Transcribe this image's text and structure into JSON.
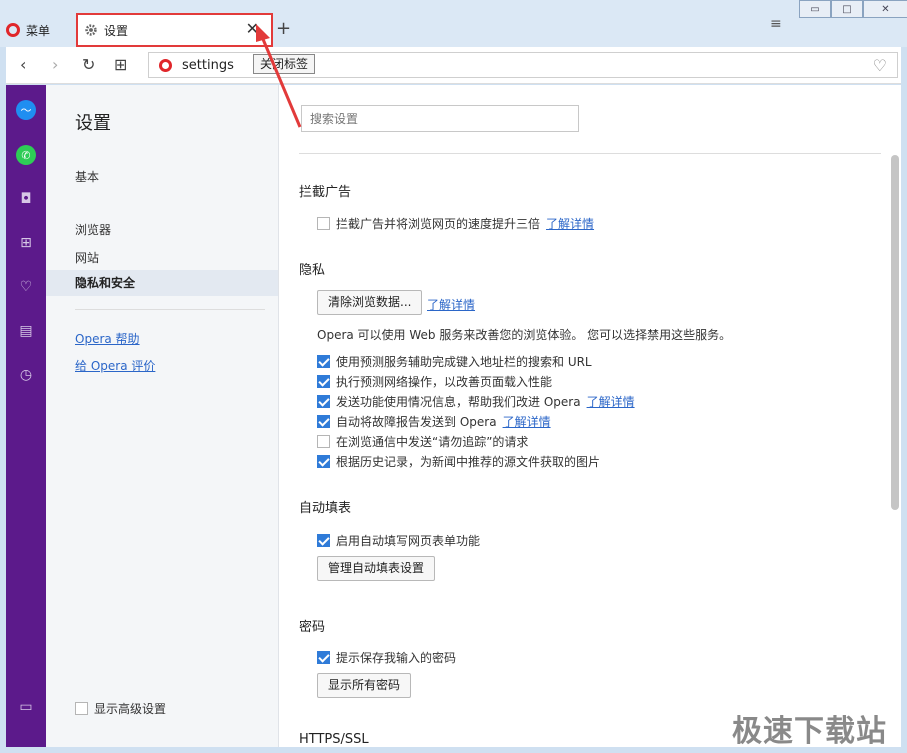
{
  "titlebar": {
    "menu_label": "菜单",
    "tab_title": "设置",
    "close_glyph": "✕",
    "new_tab_glyph": "+",
    "tab_menu_glyph": "≡",
    "tooltip": "关闭标签"
  },
  "window_controls": {
    "minimize": "▭",
    "maximize": "□",
    "close": "✕"
  },
  "addressbar": {
    "url": "settings",
    "back": "‹",
    "forward": "›",
    "reload": "↻",
    "grid": "⊞",
    "heart": "♡"
  },
  "sidebar": {
    "icons": [
      "messenger-icon",
      "whatsapp-icon",
      "camera-icon",
      "speed-dial-icon",
      "heart-icon",
      "news-icon",
      "history-icon",
      "sidebar-toggle-icon"
    ],
    "accent_color": "#5c1a8b"
  },
  "settings_nav": {
    "title": "设置",
    "items": [
      "基本",
      "浏览器",
      "网站",
      "隐私和安全"
    ],
    "active_item": "隐私和安全",
    "links": [
      "Opera 帮助",
      "给 Opera 评价"
    ],
    "advanced_label": "显示高级设置"
  },
  "content": {
    "search_placeholder": "搜索设置",
    "adblock": {
      "title": "拦截广告",
      "option": "拦截广告并将浏览网页的速度提升三倍",
      "link": "了解详情",
      "checked": false
    },
    "privacy": {
      "title": "隐私",
      "clear_button": "清除浏览数据...",
      "clear_link": "了解详情",
      "description": "Opera 可以使用 Web 服务来改善您的浏览体验。 您可以选择禁用这些服务。",
      "options": [
        {
          "label": "使用预测服务辅助完成键入地址栏的搜索和 URL",
          "checked": true,
          "link": ""
        },
        {
          "label": "执行预测网络操作，以改善页面载入性能",
          "checked": true,
          "link": ""
        },
        {
          "label": "发送功能使用情况信息，帮助我们改进 Opera",
          "checked": true,
          "link": "了解详情"
        },
        {
          "label": "自动将故障报告发送到 Opera",
          "checked": true,
          "link": "了解详情"
        },
        {
          "label": "在浏览通信中发送“请勿追踪”的请求",
          "checked": false,
          "link": ""
        },
        {
          "label": "根据历史记录，为新闻中推荐的源文件获取的图片",
          "checked": true,
          "link": ""
        }
      ]
    },
    "autofill": {
      "title": "自动填表",
      "option": "启用自动填写网页表单功能",
      "checked": true,
      "button": "管理自动填表设置"
    },
    "passwords": {
      "title": "密码",
      "option": "提示保存我输入的密码",
      "checked": true,
      "button": "显示所有密码"
    },
    "https": {
      "title": "HTTPS/SSL"
    }
  },
  "watermark": "极速下载站",
  "colors": {
    "highlight_box": "#e23a3a",
    "link": "#2b66c8",
    "checkbox": "#2f7bd8"
  }
}
